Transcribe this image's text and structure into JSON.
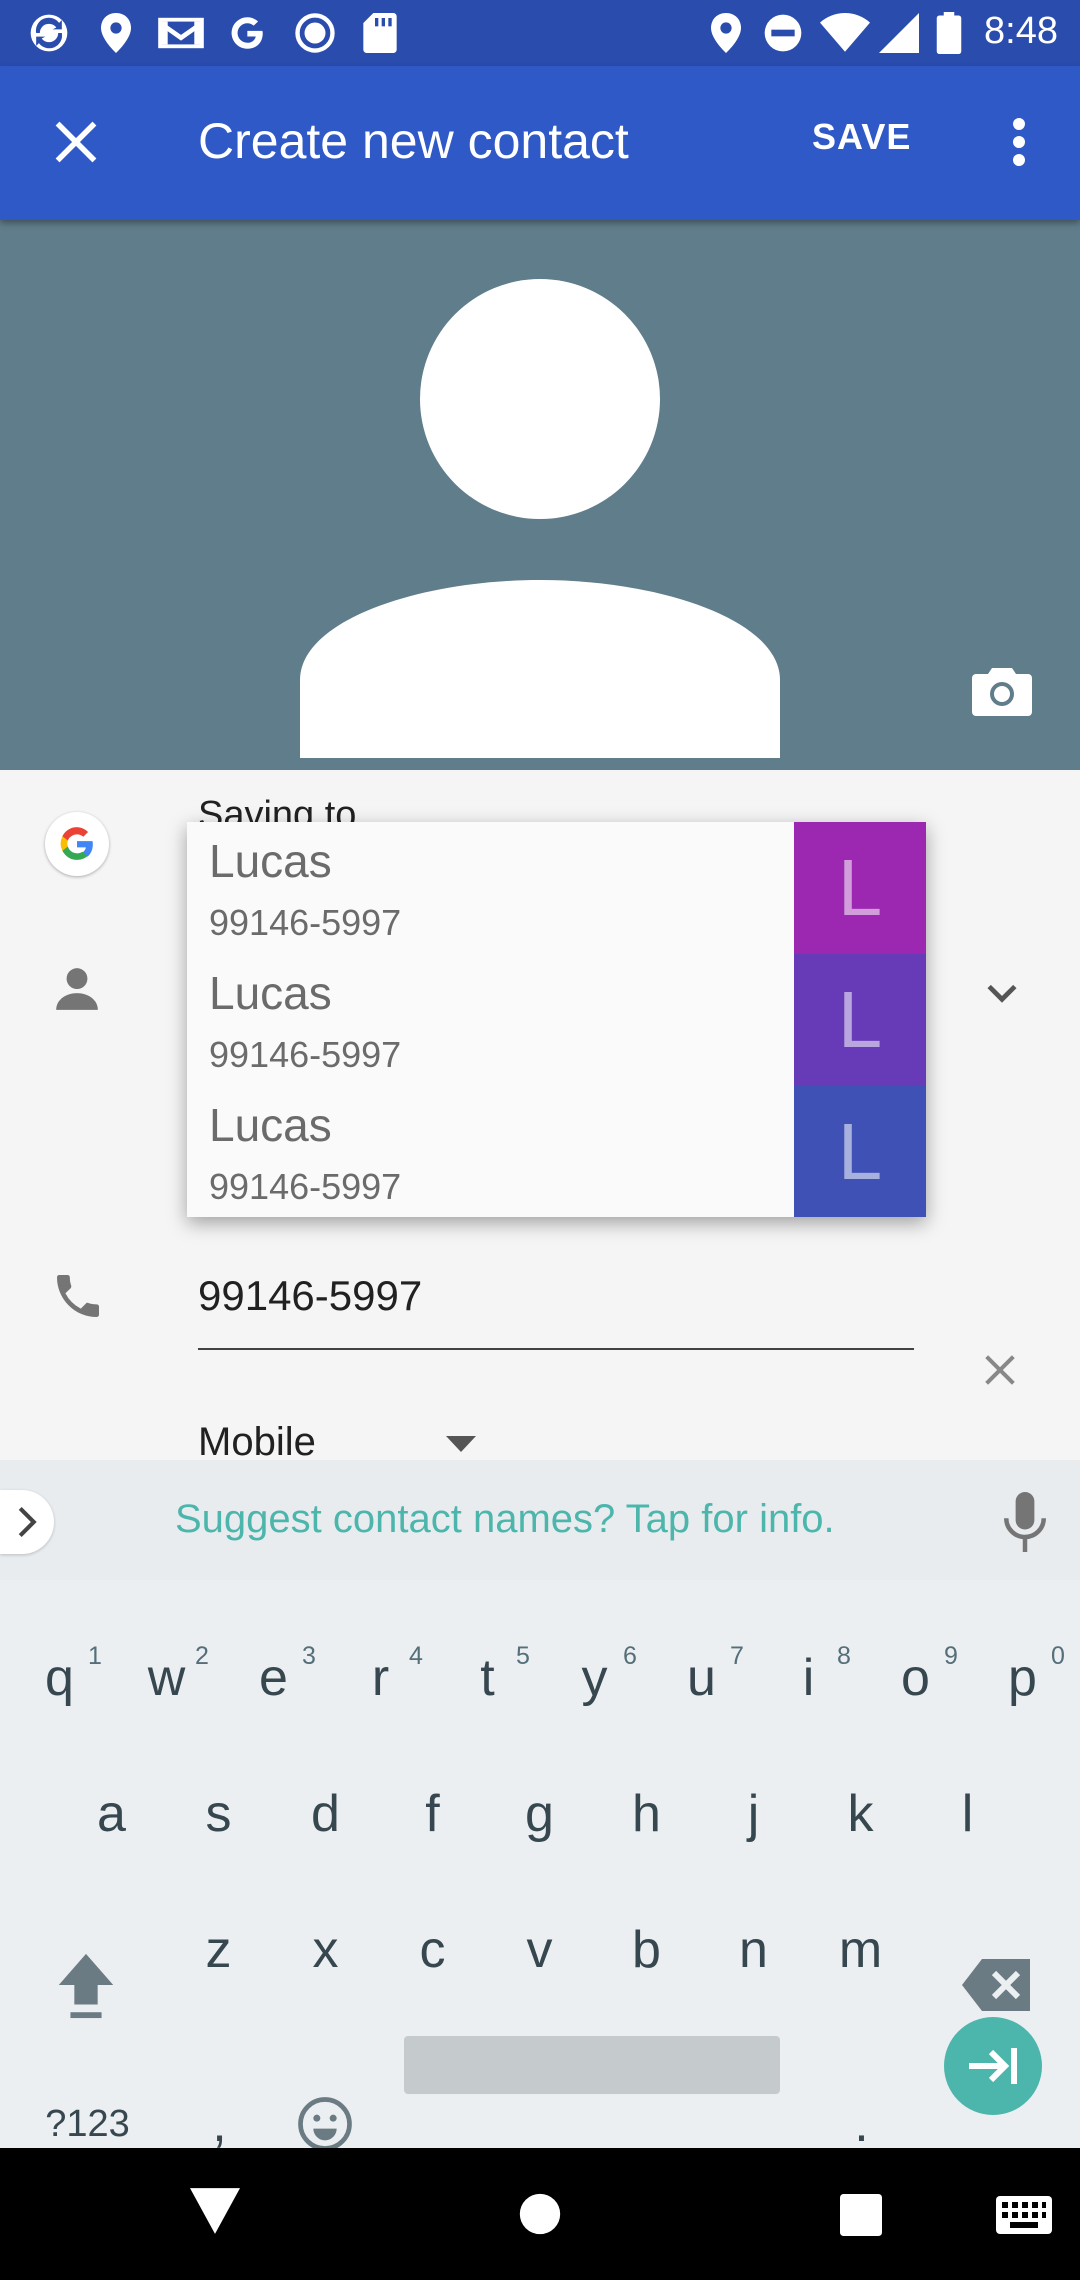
{
  "status_bar": {
    "time": "8:48",
    "left_icons": [
      "sync-icon",
      "location-icon",
      "gmail-icon",
      "google-icon",
      "record-icon",
      "sd-card-icon"
    ],
    "right_icons": [
      "location-icon",
      "do-not-disturb-icon",
      "wifi-icon",
      "signal-icon",
      "battery-icon"
    ]
  },
  "app_bar": {
    "title": "Create new contact",
    "save_label": "SAVE"
  },
  "form": {
    "saving_to": "Saving to",
    "phone": {
      "value": "99146-5997",
      "type": "Mobile"
    }
  },
  "autocomplete": [
    {
      "name": "Lucas",
      "phone": "99146-5997",
      "letter": "L",
      "color": "#9c27b0"
    },
    {
      "name": "Lucas",
      "phone": "99146-5997",
      "letter": "L",
      "color": "#673ab7"
    },
    {
      "name": "Lucas",
      "phone": "99146-5997",
      "letter": "L",
      "color": "#3f51b5"
    }
  ],
  "keyboard": {
    "suggestion_text": "Suggest contact names? Tap for info.",
    "row1": [
      "q",
      "w",
      "e",
      "r",
      "t",
      "y",
      "u",
      "i",
      "o",
      "p"
    ],
    "row1_hints": [
      "1",
      "2",
      "3",
      "4",
      "5",
      "6",
      "7",
      "8",
      "9",
      "0"
    ],
    "row2": [
      "a",
      "s",
      "d",
      "f",
      "g",
      "h",
      "j",
      "k",
      "l"
    ],
    "row3": [
      "z",
      "x",
      "c",
      "v",
      "b",
      "n",
      "m"
    ],
    "symbols_label": "?123",
    "comma": ",",
    "period": "."
  },
  "colors": {
    "app_bar": "#2f59c6",
    "status_bar": "#2a4cad",
    "photo_bg": "#607d8b",
    "accent_teal": "#4db6ac"
  }
}
